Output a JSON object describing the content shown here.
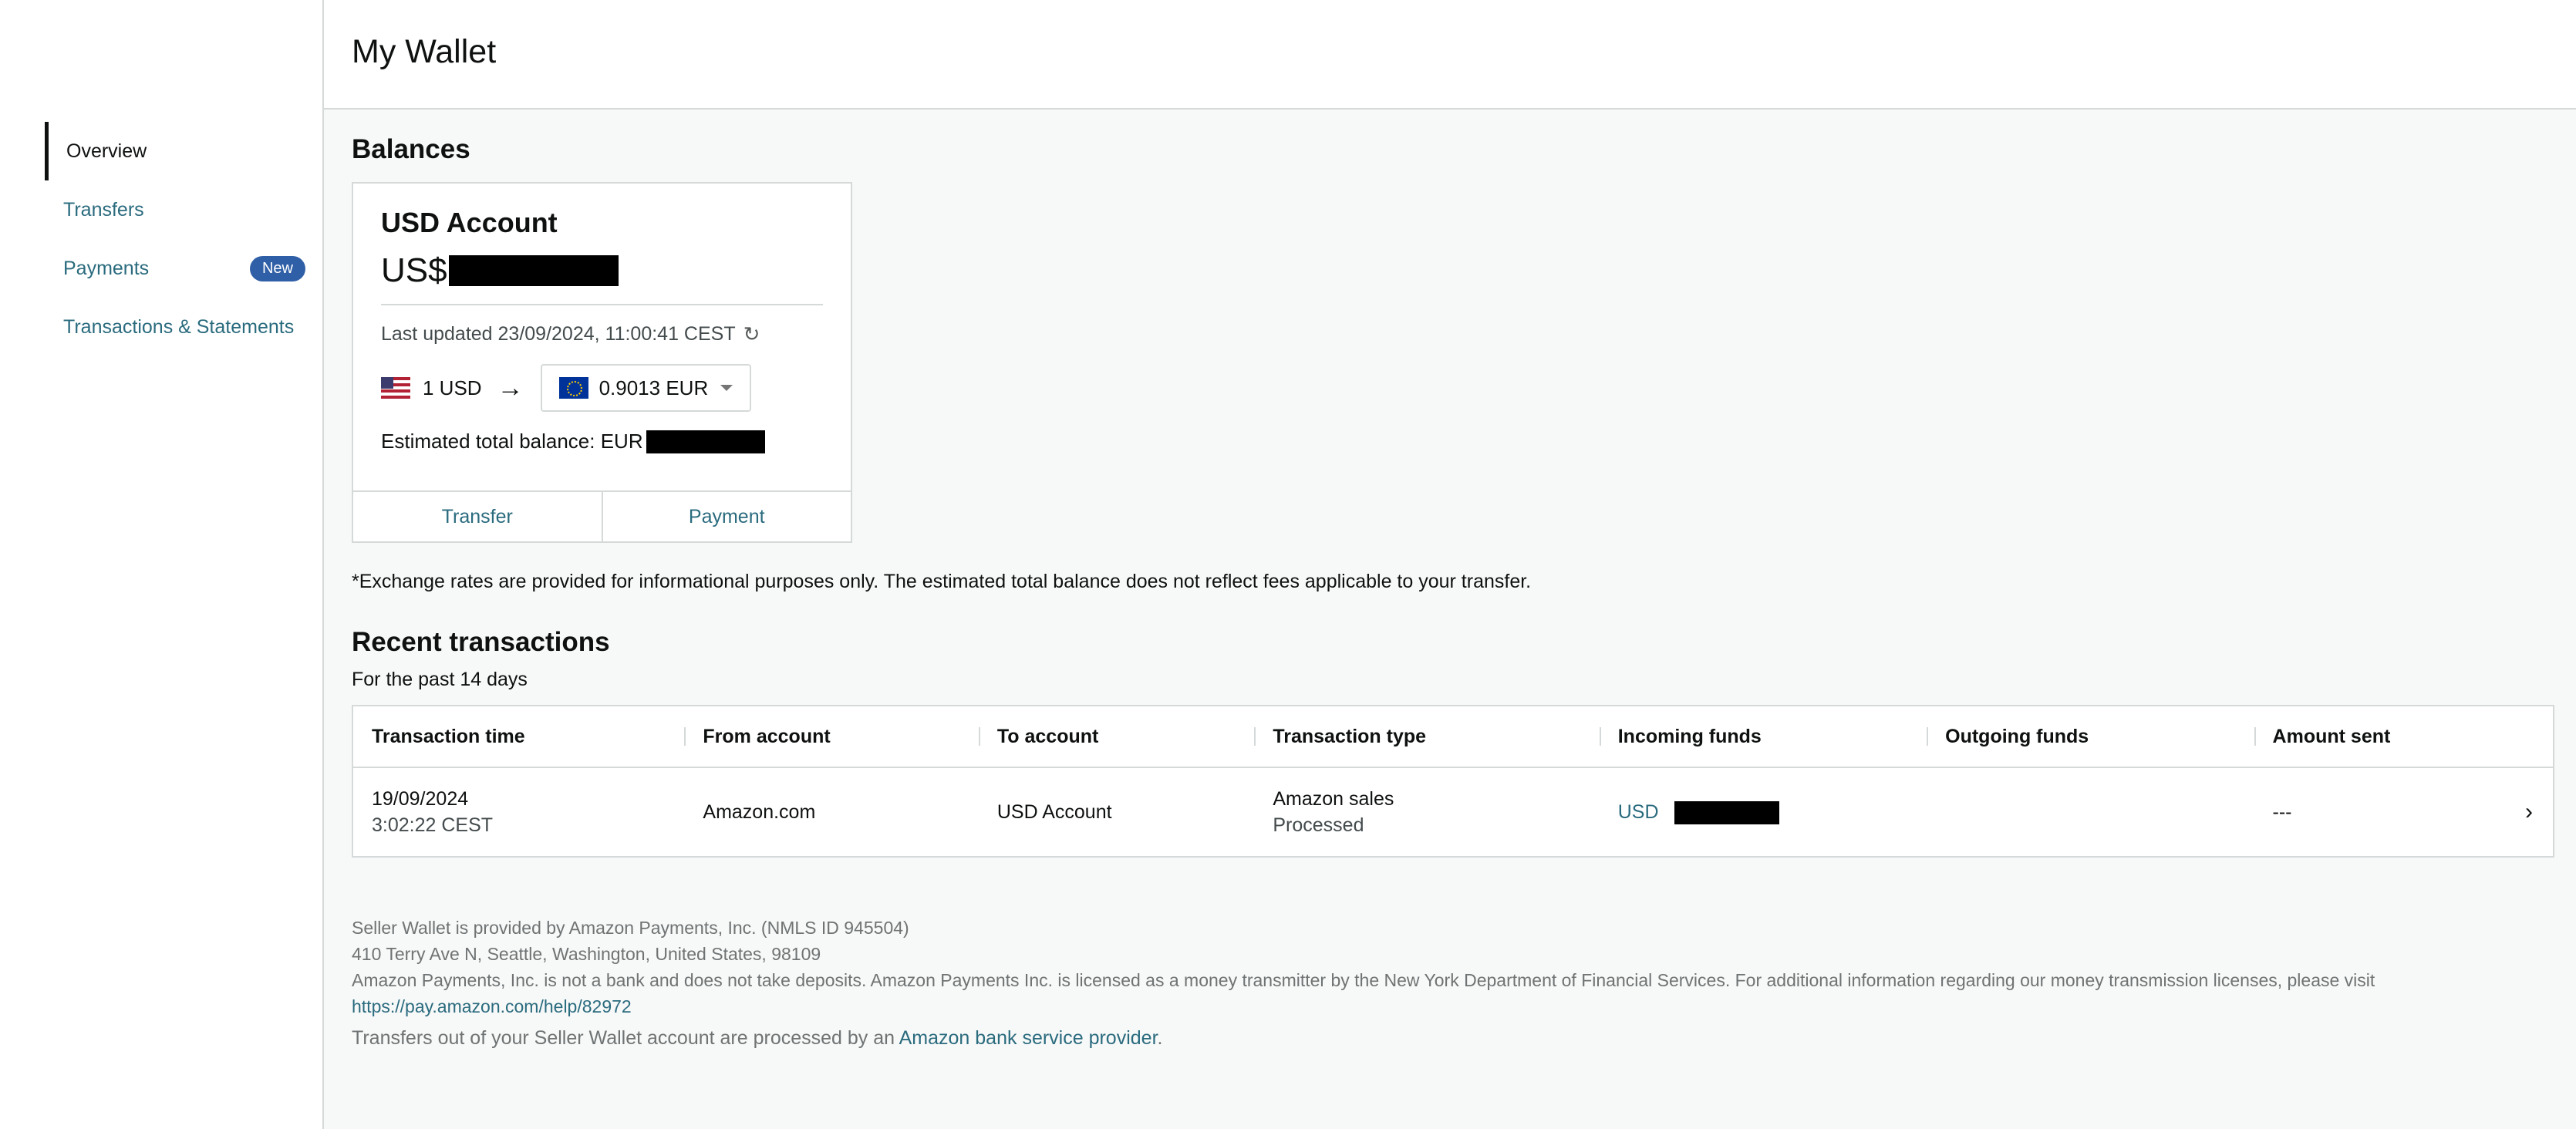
{
  "page": {
    "title": "My Wallet"
  },
  "sidebar": {
    "items": [
      {
        "label": "Overview"
      },
      {
        "label": "Transfers"
      },
      {
        "label": "Payments",
        "badge": "New"
      },
      {
        "label": "Transactions & Statements"
      }
    ]
  },
  "balances": {
    "title": "Balances",
    "card": {
      "account_title": "USD Account",
      "currency_prefix": "US$",
      "last_updated": "Last updated 23/09/2024, 11:00:41 CEST",
      "rate_from": "1 USD",
      "rate_to": "0.9013 EUR",
      "estimated_label": "Estimated total balance: EUR",
      "transfer_label": "Transfer",
      "payment_label": "Payment"
    },
    "disclaimer": "*Exchange rates are provided for informational purposes only. The estimated total balance does not reflect fees applicable to your transfer."
  },
  "recent": {
    "title": "Recent transactions",
    "subtitle": "For the past 14 days",
    "columns": [
      "Transaction time",
      "From account",
      "To account",
      "Transaction type",
      "Incoming funds",
      "Outgoing funds",
      "Amount sent"
    ],
    "rows": [
      {
        "date": "19/09/2024",
        "time": "3:02:22 CEST",
        "from": "Amazon.com",
        "to": "USD Account",
        "type": "Amazon sales",
        "status": "Processed",
        "incoming_currency": "USD",
        "outgoing": "",
        "amount_sent": "---"
      }
    ]
  },
  "footer": {
    "line1": "Seller Wallet is provided by Amazon Payments, Inc. (NMLS ID 945504)",
    "line2": "410 Terry Ave N, Seattle, Washington, United States, 98109",
    "line3": "Amazon Payments, Inc. is not a bank and does not take deposits. Amazon Payments Inc. is licensed as a money transmitter by the New York Department of Financial Services. For additional information regarding our money transmission licenses, please visit",
    "link": "https://pay.amazon.com/help/82972",
    "transfers_prefix": "Transfers out of your Seller Wallet account are processed by an",
    "transfers_link": "Amazon bank service provider",
    "transfers_suffix": "."
  },
  "icons": {
    "refresh": "refresh-icon",
    "arrow": "arrow-right-icon",
    "caret": "caret-down-icon",
    "chevron": "chevron-right-icon",
    "flag_from": "us-flag-icon",
    "flag_to": "eu-flag-icon"
  }
}
